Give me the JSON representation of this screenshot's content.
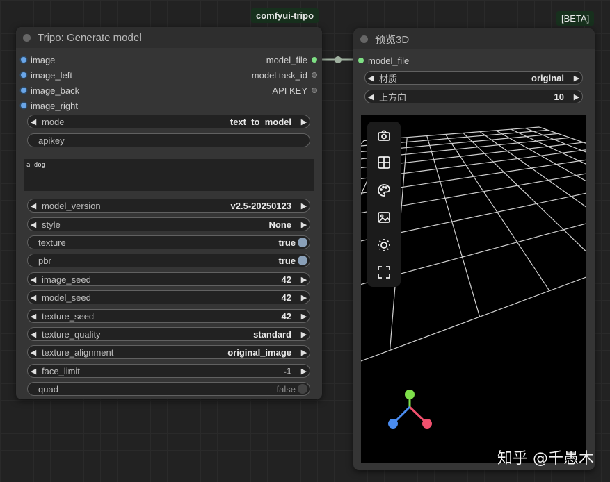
{
  "badges": {
    "group": "comfyui-tripo",
    "beta": "[BETA]"
  },
  "tripo": {
    "title": "Tripo: Generate model",
    "inputs": [
      "image",
      "image_left",
      "image_back",
      "image_right"
    ],
    "outputs": [
      "model_file",
      "model task_id",
      "API KEY"
    ],
    "mode": {
      "label": "mode",
      "value": "text_to_model"
    },
    "apikey": {
      "label": "apikey"
    },
    "prompt": "a dog",
    "model_version": {
      "label": "model_version",
      "value": "v2.5-20250123"
    },
    "style": {
      "label": "style",
      "value": "None"
    },
    "texture": {
      "label": "texture",
      "value": "true"
    },
    "pbr": {
      "label": "pbr",
      "value": "true"
    },
    "image_seed": {
      "label": "image_seed",
      "value": "42"
    },
    "model_seed": {
      "label": "model_seed",
      "value": "42"
    },
    "texture_seed": {
      "label": "texture_seed",
      "value": "42"
    },
    "texture_quality": {
      "label": "texture_quality",
      "value": "standard"
    },
    "texture_alignment": {
      "label": "texture_alignment",
      "value": "original_image"
    },
    "face_limit": {
      "label": "face_limit",
      "value": "-1"
    },
    "quad": {
      "label": "quad",
      "value": "false"
    }
  },
  "preview": {
    "title": "预览3D",
    "input": "model_file",
    "material": {
      "label": "材质",
      "value": "original"
    },
    "up_direction": {
      "label": "上方向",
      "value": "10"
    },
    "toolbar_icons": [
      "camera-icon",
      "grid-icon",
      "palette-icon",
      "image-icon",
      "light-icon",
      "fullscreen-icon"
    ]
  },
  "watermark": "知乎 @千愚木",
  "colors": {
    "accent_green": "#7ee084",
    "input_blue": "#6aa6e8",
    "axis_x": "#f0506e",
    "axis_y": "#7ee04a",
    "axis_z": "#4a8cf0"
  }
}
